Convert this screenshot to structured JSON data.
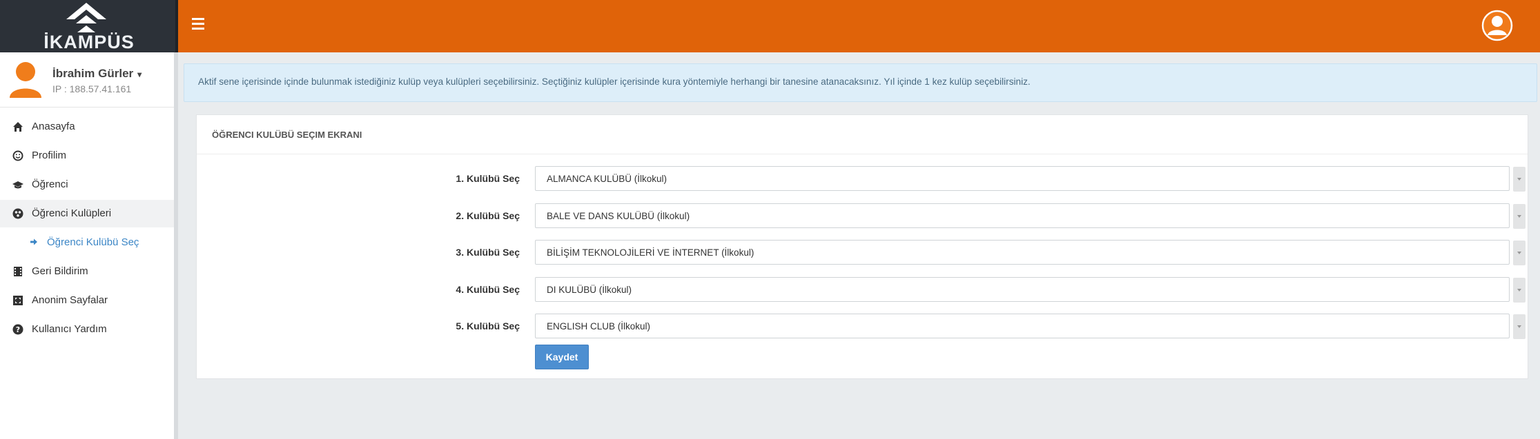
{
  "brand": {
    "logo_text": "İKAMPÜS"
  },
  "colors": {
    "topbar": "#e06309",
    "logo_bg": "#2c3138",
    "link": "#3c86c6",
    "primary_button": "#4d8fd1",
    "alert_bg": "#ddeef9"
  },
  "user": {
    "name": "İbrahim Gürler",
    "ip": "IP : 188.57.41.161"
  },
  "sidebar": {
    "items": [
      {
        "label": "Anasayfa",
        "icon": "home-icon"
      },
      {
        "label": "Profilim",
        "icon": "smile-icon"
      },
      {
        "label": "Öğrenci",
        "icon": "graduation-cap-icon"
      },
      {
        "label": "Öğrenci Kulüpleri",
        "icon": "globe-icon",
        "active": true
      },
      {
        "label": "Öğrenci Kulübü Seç",
        "icon": "arrow-right-icon",
        "sub": true
      },
      {
        "label": "Geri Bildirim",
        "icon": "film-icon"
      },
      {
        "label": "Anonim Sayfalar",
        "icon": "expand-icon"
      },
      {
        "label": "Kullanıcı Yardım",
        "icon": "question-circle-icon"
      }
    ]
  },
  "alert": {
    "text": "Aktif sene içerisinde içinde bulunmak istediğiniz kulüp veya kulüpleri seçebilirsiniz. Seçtiğiniz kulüpler içerisinde kura yöntemiyle herhangi bir tanesine atanacaksınız. Yıl içinde 1 kez kulüp seçebilirsiniz."
  },
  "panel": {
    "title": "ÖĞRENCI KULÜBÜ SEÇIM EKRANI",
    "rows": [
      {
        "label": "1. Kulübü Seç",
        "value": "ALMANCA KULÜBÜ (İlkokul)"
      },
      {
        "label": "2. Kulübü Seç",
        "value": "BALE VE DANS KULÜBÜ (İlkokul)"
      },
      {
        "label": "3. Kulübü Seç",
        "value": "BİLİŞİM TEKNOLOJİLERİ VE İNTERNET (İlkokul)"
      },
      {
        "label": "4. Kulübü Seç",
        "value": "DI KULÜBÜ (İlkokul)"
      },
      {
        "label": "5. Kulübü Seç",
        "value": "ENGLISH CLUB (İlkokul)"
      }
    ],
    "save_label": "Kaydet"
  }
}
